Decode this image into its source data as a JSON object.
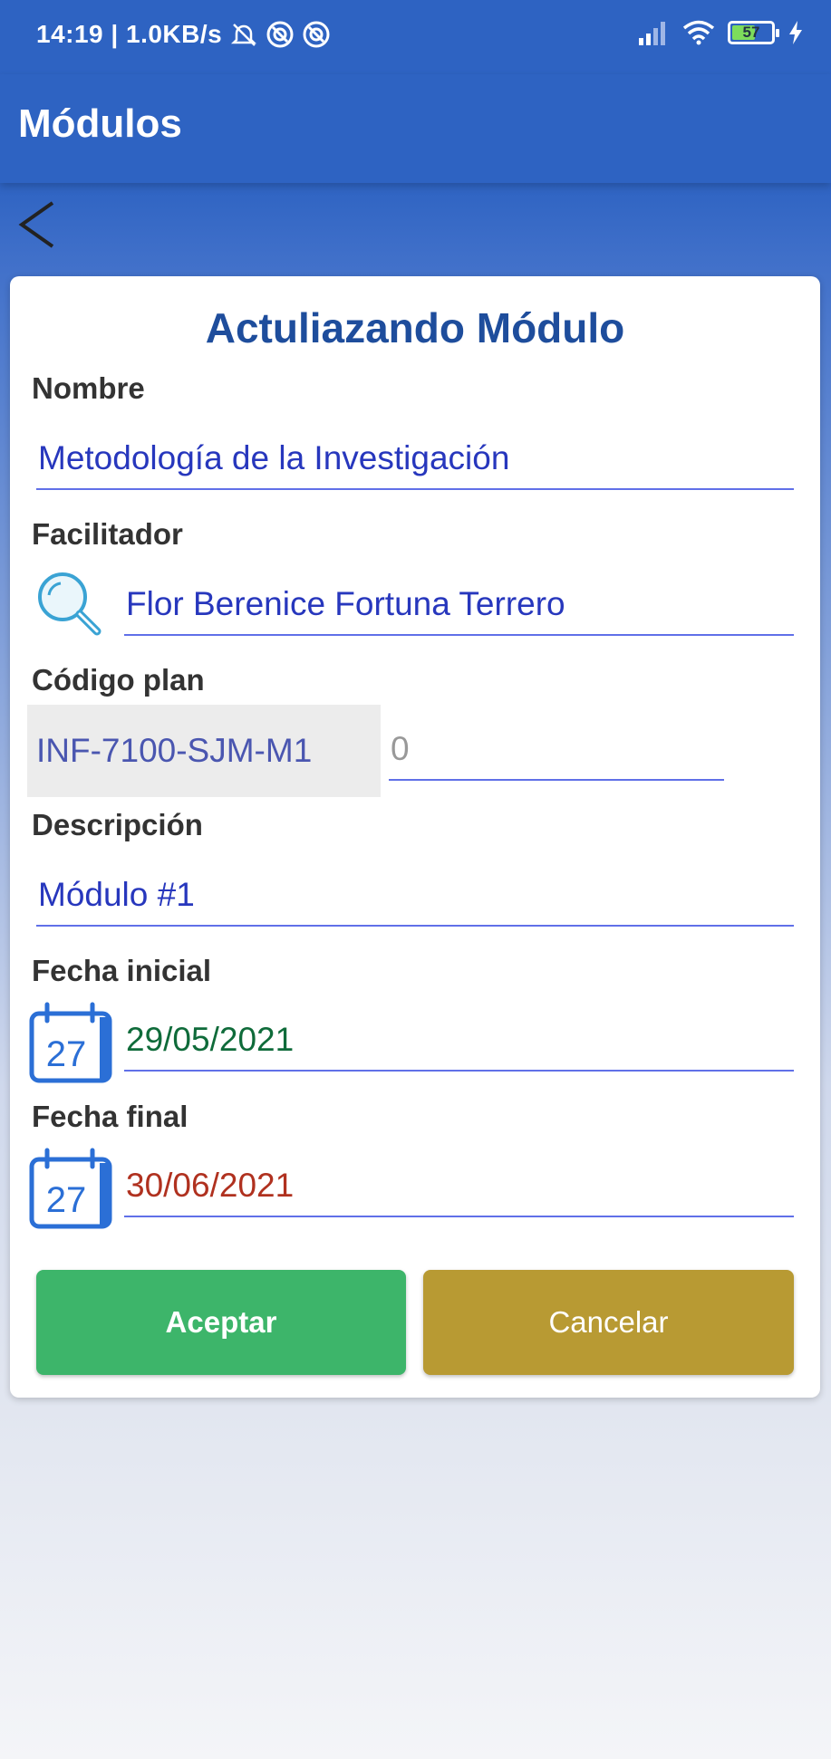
{
  "status_bar": {
    "time_speed": "14:19 | 1.0KB/s",
    "battery": "57"
  },
  "app_bar": {
    "title": "Módulos"
  },
  "form": {
    "title": "Actuliazando Módulo",
    "nombre_label": "Nombre",
    "nombre_value": "Metodología de la Investigación",
    "facilitador_label": "Facilitador",
    "facilitador_value": "Flor Berenice Fortuna Terrero",
    "codigo_label": "Código plan",
    "codigo_prefix": "INF-7100-SJM-M1",
    "codigo_suffix": "0",
    "descripcion_label": "Descripción",
    "descripcion_value": "Módulo #1",
    "fecha_inicial_label": "Fecha inicial",
    "fecha_inicial_value": "29/05/2021",
    "fecha_final_label": "Fecha final",
    "fecha_final_value": "30/06/2021",
    "calendar_day": "27"
  },
  "buttons": {
    "accept": "Aceptar",
    "cancel": "Cancelar"
  },
  "colors": {
    "primary": "#2e63c2",
    "title": "#1e4d9c",
    "field_text": "#2737bd",
    "date_initial": "#0f6b3a",
    "date_final": "#b0311f",
    "accept": "#3db56a",
    "cancel": "#b89a33"
  },
  "icons": [
    "silent-bell-icon",
    "sync-icon",
    "cell-signal-icon",
    "wifi-icon",
    "battery-icon",
    "charging-bolt-icon",
    "back-arrow-icon",
    "search-magnifier-icon",
    "calendar-icon"
  ]
}
